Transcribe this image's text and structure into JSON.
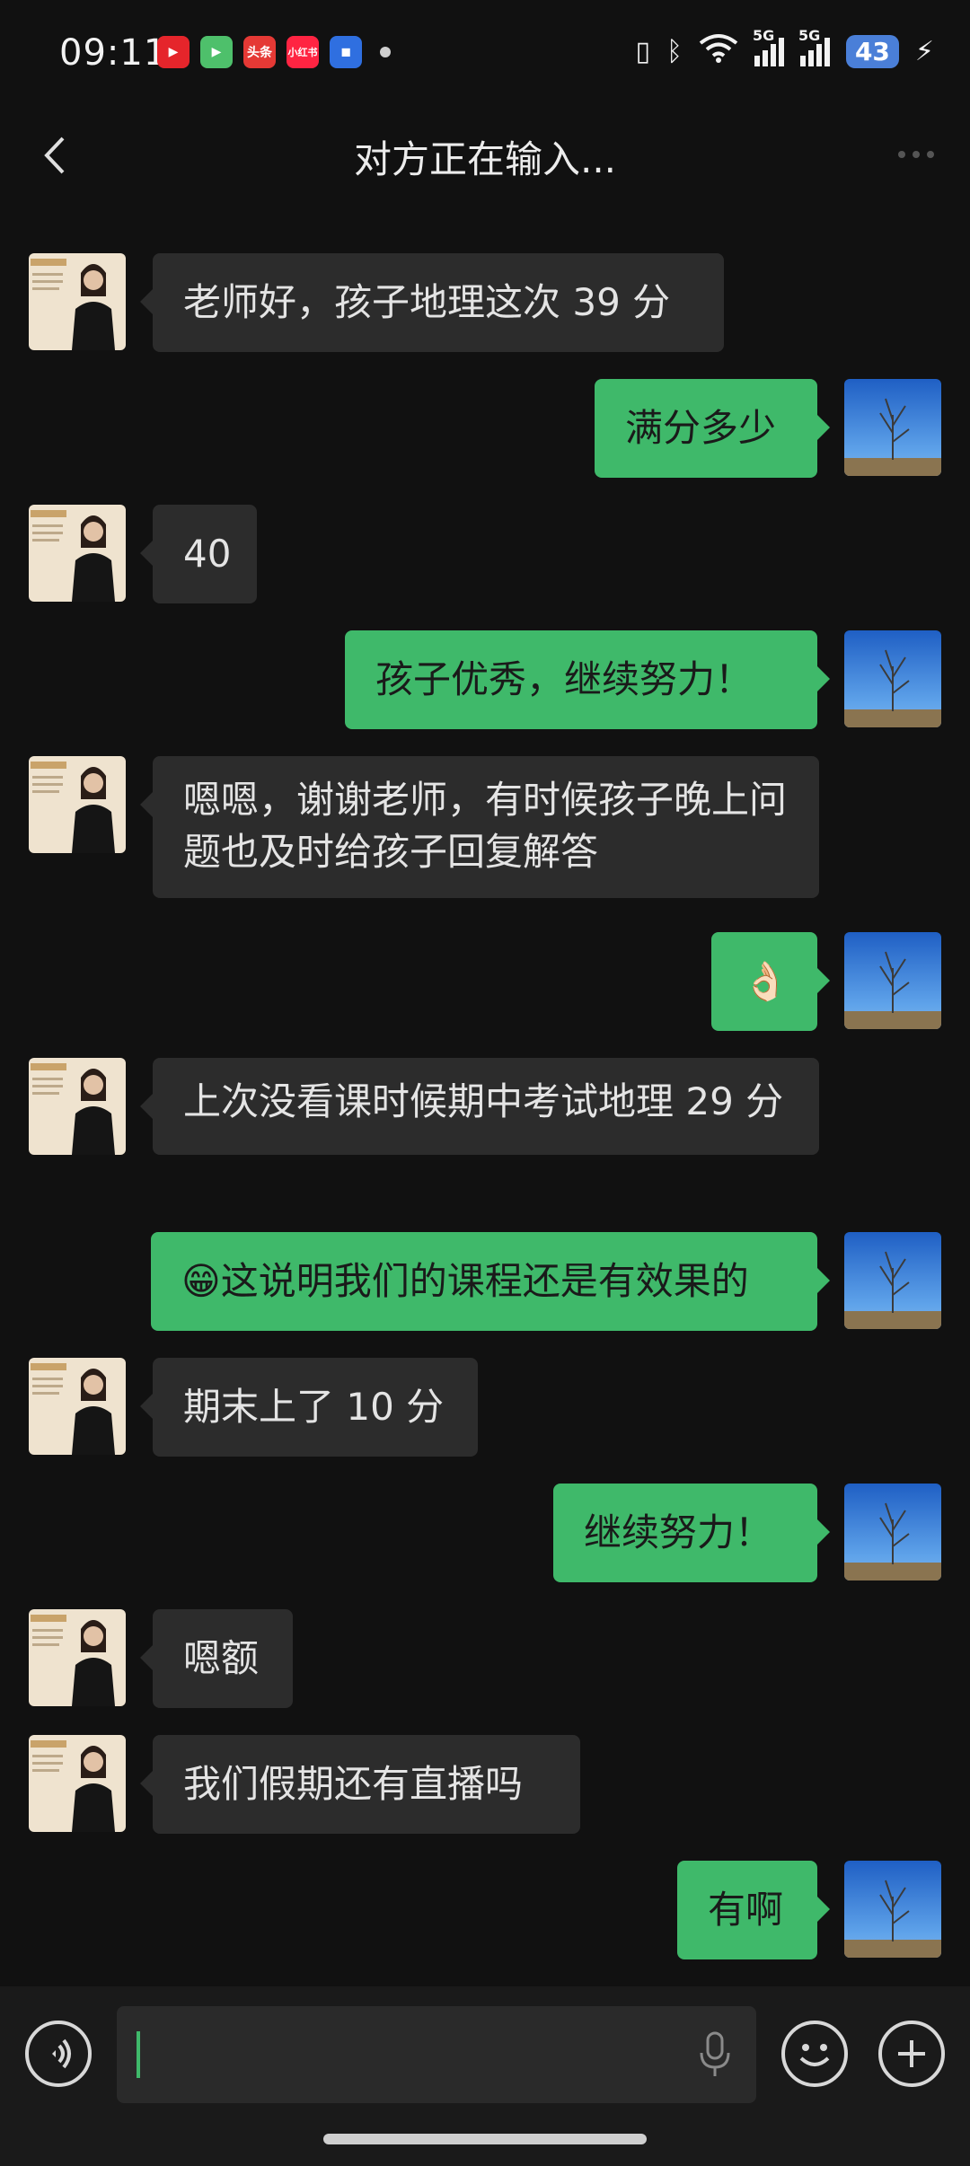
{
  "status": {
    "time": "09:11",
    "battery": "43",
    "network": "5G",
    "app_icons": [
      {
        "name": "video-app-icon",
        "color": "#e5252b",
        "label": ""
      },
      {
        "name": "media-app-icon",
        "color": "#4ec06b",
        "label": ""
      },
      {
        "name": "toutiao-app-icon",
        "color": "#e53935",
        "label": "头条"
      },
      {
        "name": "xiaohongshu-app-icon",
        "color": "#ff2442",
        "label": "小红书"
      },
      {
        "name": "blue-app-icon",
        "color": "#2f6fe0",
        "label": ""
      }
    ]
  },
  "header": {
    "title": "对方正在输入..."
  },
  "messages": [
    {
      "side": "in",
      "text": "老师好，孩子地理这次 39 分"
    },
    {
      "side": "out",
      "text": "满分多少"
    },
    {
      "side": "in",
      "text": "40"
    },
    {
      "side": "out",
      "text": "孩子优秀，继续努力！"
    },
    {
      "side": "in",
      "text": "嗯嗯，谢谢老师，有时候孩子晚上问题也及时给孩子回复解答"
    },
    {
      "side": "out",
      "text": "👌🏻"
    },
    {
      "side": "in",
      "text": "上次没看课时候期中考试地理 29 分"
    },
    {
      "side": "out",
      "text": "😁这说明我们的课程还是有效果的"
    },
    {
      "side": "in",
      "text": "期末上了 10 分"
    },
    {
      "side": "out",
      "text": "继续努力！"
    },
    {
      "side": "in",
      "text": "嗯额"
    },
    {
      "side": "in",
      "text": "我们假期还有直播吗"
    },
    {
      "side": "out",
      "text": "有啊"
    }
  ],
  "colors": {
    "background": "#111111",
    "incoming_bubble": "#2c2c2c",
    "outgoing_bubble": "#3fb96a",
    "cursor": "#3fb96a"
  },
  "input": {
    "value": ""
  }
}
